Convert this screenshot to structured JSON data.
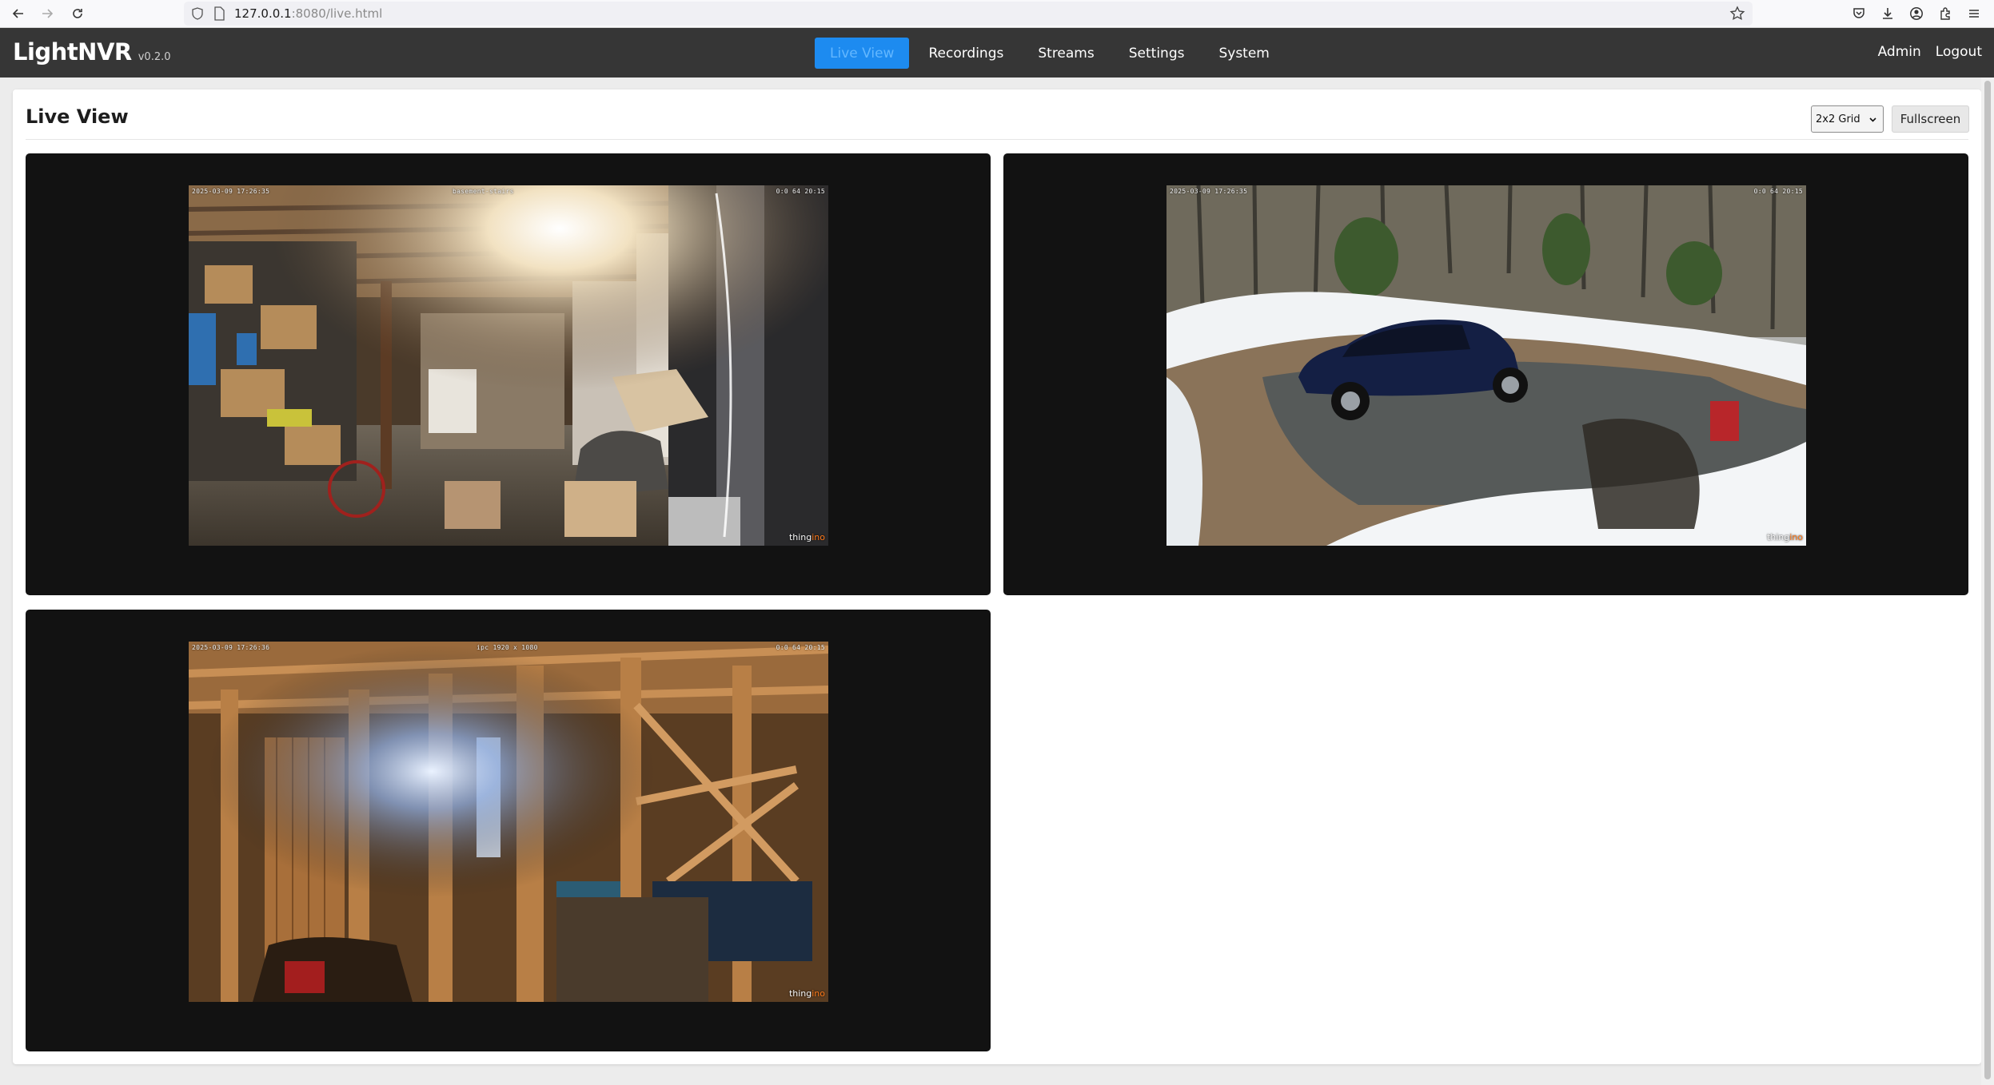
{
  "browser": {
    "url_host": "127.0.0.1",
    "url_rest": ":8080/live.html",
    "icons": [
      "back-arrow-icon",
      "forward-arrow-icon",
      "reload-icon",
      "shield-icon",
      "page-icon",
      "bookmark-star-icon",
      "pocket-icon",
      "download-icon",
      "account-icon",
      "extensions-icon",
      "menu-icon"
    ]
  },
  "header": {
    "brand": "LightNVR",
    "version": "v0.2.0",
    "nav": [
      {
        "label": "Live View",
        "active": true
      },
      {
        "label": "Recordings",
        "active": false
      },
      {
        "label": "Streams",
        "active": false
      },
      {
        "label": "Settings",
        "active": false
      },
      {
        "label": "System",
        "active": false
      }
    ],
    "user": "Admin",
    "logout": "Logout"
  },
  "page": {
    "title": "Live View",
    "layout_selected": "2x2 Grid",
    "fullscreen_label": "Fullscreen"
  },
  "streams": [
    {
      "osd_left": "2025-03-09 17:26:35",
      "osd_center": "basement-stairs",
      "osd_right": "0:0 64 20:15",
      "watermark_a": "thing",
      "watermark_b": "ino",
      "scene": "basement"
    },
    {
      "osd_left": "2025-03-09 17:26:35",
      "osd_center": "",
      "osd_right": "0:0 64 20:15",
      "watermark_a": "thing",
      "watermark_b": "ino",
      "scene": "driveway"
    },
    {
      "osd_left": "2025-03-09 17:26:36",
      "osd_center": "ipc 1920 x 1080",
      "osd_right": "0:0 64 20:15",
      "watermark_a": "thing",
      "watermark_b": "ino",
      "scene": "barn"
    }
  ],
  "colors": {
    "header_bg": "#363636",
    "accent": "#1d8bf0",
    "tile_bg": "#121212",
    "page_bg": "#ececec"
  }
}
